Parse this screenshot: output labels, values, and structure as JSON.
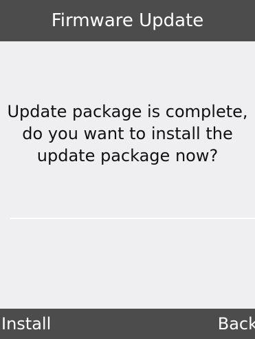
{
  "title_bar": {
    "title": "Firmware Update"
  },
  "dialog": {
    "message": "Update package is complete, do you want to install the update package now?"
  },
  "softkeys": {
    "left_label": "Install",
    "right_label": "Back"
  },
  "colors": {
    "bar_background": "#4c4c4c",
    "content_background": "#efeff2",
    "text_dark": "#111111",
    "text_light": "#ffffff"
  }
}
